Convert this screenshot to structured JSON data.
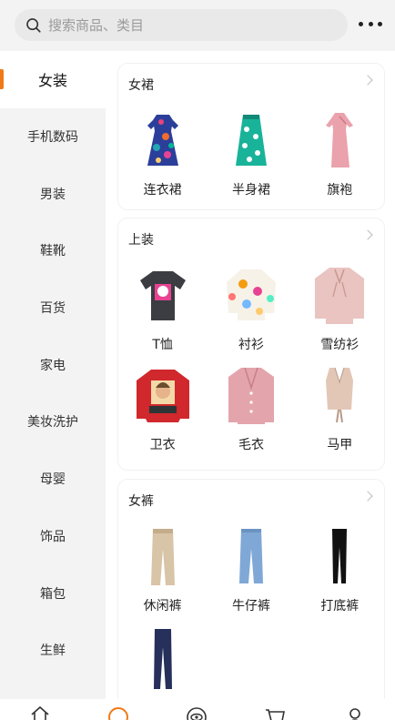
{
  "search": {
    "placeholder": "搜索商品、类目",
    "icon": "search-icon"
  },
  "header": {
    "more_icon": "more-icon"
  },
  "sidebar": {
    "items": [
      {
        "label": "女装",
        "active": true
      },
      {
        "label": "手机数码"
      },
      {
        "label": "男装"
      },
      {
        "label": "鞋靴"
      },
      {
        "label": "百货"
      },
      {
        "label": "家电"
      },
      {
        "label": "美妆洗护"
      },
      {
        "label": "母婴"
      },
      {
        "label": "饰品"
      },
      {
        "label": "箱包"
      },
      {
        "label": "生鲜"
      }
    ],
    "accent": "#f07a18"
  },
  "sections": [
    {
      "title": "女裙",
      "products": [
        {
          "label": "连衣裙",
          "icon": "floral-dress-icon"
        },
        {
          "label": "半身裙",
          "icon": "green-skirt-icon"
        },
        {
          "label": "旗袍",
          "icon": "qipao-icon"
        }
      ]
    },
    {
      "title": "上装",
      "products": [
        {
          "label": "T恤",
          "icon": "tshirt-icon"
        },
        {
          "label": "衬衫",
          "icon": "shirt-icon"
        },
        {
          "label": "雪纺衫",
          "icon": "chiffon-blouse-icon"
        },
        {
          "label": "卫衣",
          "icon": "sweatshirt-icon"
        },
        {
          "label": "毛衣",
          "icon": "sweater-icon"
        },
        {
          "label": "马甲",
          "icon": "vest-icon"
        }
      ]
    },
    {
      "title": "女裤",
      "products": [
        {
          "label": "休闲裤",
          "icon": "casual-pants-icon"
        },
        {
          "label": "牛仔裤",
          "icon": "jeans-icon"
        },
        {
          "label": "打底裤",
          "icon": "leggings-icon"
        },
        {
          "label": "",
          "icon": "trousers-icon"
        }
      ]
    }
  ],
  "tabbar": {
    "items": [
      {
        "icon": "home-icon"
      },
      {
        "icon": "category-icon",
        "active": true
      },
      {
        "icon": "eye-icon"
      },
      {
        "icon": "cart-icon"
      },
      {
        "icon": "profile-icon"
      }
    ]
  }
}
